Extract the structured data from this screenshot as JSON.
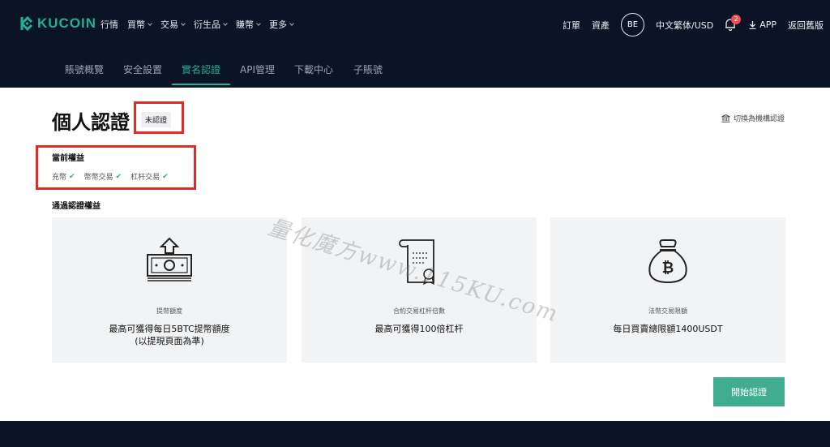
{
  "brand": {
    "name": "KUCOIN",
    "color": "#23af91"
  },
  "main_nav": [
    {
      "label": "行情",
      "dropdown": false
    },
    {
      "label": "買幣",
      "dropdown": true
    },
    {
      "label": "交易",
      "dropdown": true
    },
    {
      "label": "衍生品",
      "dropdown": true
    },
    {
      "label": "賺幣",
      "dropdown": true
    },
    {
      "label": "更多",
      "dropdown": true
    }
  ],
  "right_nav": {
    "orders": "訂單",
    "assets": "資產",
    "avatar": "BE",
    "language": "中文繁体/USD",
    "notification_count": "2",
    "app": "APP",
    "old_version": "返回舊版"
  },
  "sub_nav": [
    {
      "label": "賬號概覽",
      "active": false
    },
    {
      "label": "安全設置",
      "active": false
    },
    {
      "label": "實名認證",
      "active": true
    },
    {
      "label": "API管理",
      "active": false
    },
    {
      "label": "下載中心",
      "active": false
    },
    {
      "label": "子賬號",
      "active": false
    }
  ],
  "page": {
    "title": "個人認證",
    "status": "未認證",
    "switch_link": "切換為機構認證",
    "current_rights_title": "當前權益",
    "current_rights": [
      "充幣",
      "幣幣交易",
      "杠杆交易"
    ],
    "pass_rights_title": "通過認證權益",
    "cards": [
      {
        "icon": "withdraw-money-icon",
        "label": "提幣額度",
        "value_line1": "最高可獲得每日5BTC提幣額度",
        "value_line2": "(以提現頁面為準)"
      },
      {
        "icon": "contract-document-icon",
        "label": "合約交易杠杆倍數",
        "value_line1": "最高可獲得100倍杠杆",
        "value_line2": ""
      },
      {
        "icon": "bitcoin-bag-icon",
        "label": "法幣交易限額",
        "value_line1": "每日買賣總限額1400USDT",
        "value_line2": ""
      }
    ],
    "start_button": "開始認證"
  },
  "watermark": "量化魔方www.115KU.com",
  "colors": {
    "accent": "#23af91",
    "nav_bg": "#0b1426",
    "button": "#3fad8e",
    "highlight_box": "#e02b2b"
  }
}
